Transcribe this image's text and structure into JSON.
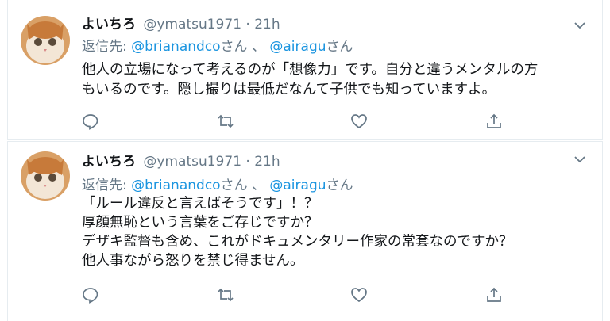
{
  "tweets": [
    {
      "author": {
        "name": "よいちろ",
        "handle": "@ymatsu1971"
      },
      "separator": "·",
      "time": "21h",
      "reply_to": {
        "prefix": "返信先:",
        "mention1": "@brianandco",
        "suffix1": "さん",
        "sep": "、",
        "mention2": "@airagu",
        "suffix2": "さん"
      },
      "lines": [
        "他人の立場になって考えるのが「想像力」です。自分と違うメンタルの方",
        "もいるのです。隠し撮りは最低だなんて子供でも知っていますよ。"
      ],
      "actions": [
        "reply-icon",
        "retweet-icon",
        "like-icon",
        "share-icon"
      ]
    },
    {
      "author": {
        "name": "よいちろ",
        "handle": "@ymatsu1971"
      },
      "separator": "·",
      "time": "21h",
      "reply_to": {
        "prefix": "返信先:",
        "mention1": "@brianandco",
        "suffix1": "さん",
        "sep": "、",
        "mention2": "@airagu",
        "suffix2": "さん"
      },
      "lines": [
        "「ルール違反と言えばそうです」！？",
        "厚顔無恥という言葉をご存じですか？",
        "デザキ監督も含め、これがドキュメンタリー作家の常套なのですか？",
        "他人事ながら怒りを禁じ得ません。"
      ],
      "actions": [
        "reply-icon",
        "retweet-icon",
        "like-icon",
        "share-icon"
      ]
    }
  ],
  "colors": {
    "text": "#14171a",
    "muted": "#657786",
    "link": "#1b95e0",
    "border": "#e6ecf0"
  }
}
